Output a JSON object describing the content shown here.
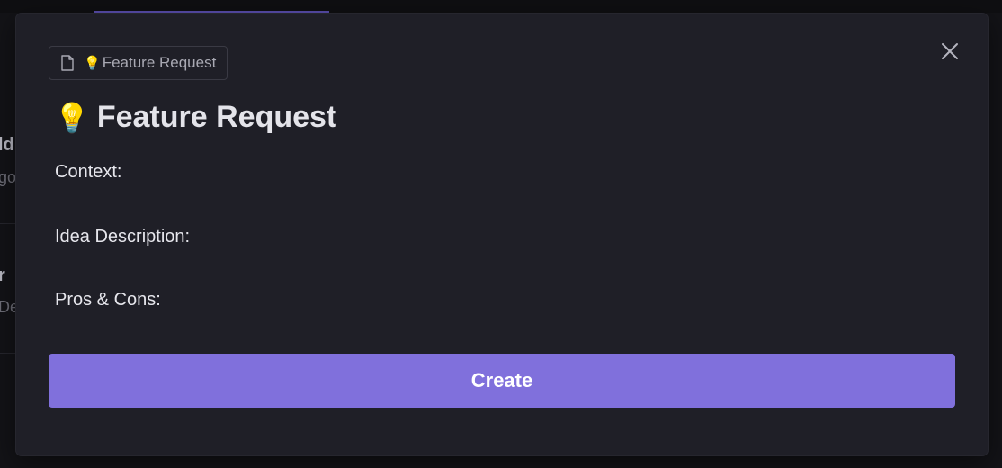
{
  "background": {
    "row1_title_fragment": "ld",
    "row1_meta_fragment": "go",
    "row2_title_fragment": "r",
    "row2_meta_fragment": "De"
  },
  "modal": {
    "template_chip": {
      "icon": "file-icon",
      "emoji": "💡",
      "label": "Feature Request"
    },
    "close_icon": "close-icon",
    "title": {
      "emoji": "💡",
      "text": "Feature Request"
    },
    "fields": [
      {
        "label": "Context:"
      },
      {
        "label": "Idea Description:"
      },
      {
        "label": "Pros & Cons:"
      }
    ],
    "create_button_label": "Create"
  },
  "colors": {
    "accent": "#8070dc",
    "modal_bg": "#1f1f27",
    "page_bg": "#131317",
    "text_primary": "#e4e4ea",
    "text_muted": "#a9a9b3"
  }
}
